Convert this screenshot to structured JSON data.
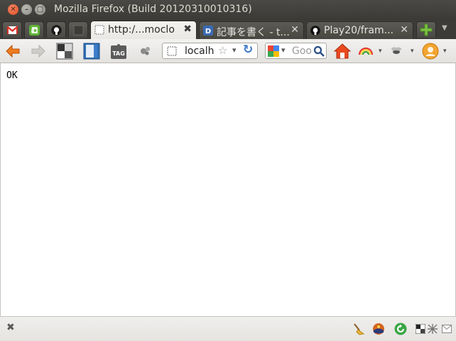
{
  "window": {
    "title": "Mozilla Firefox (Build 20120310010316)",
    "close_glyph": "✕",
    "minimize_glyph": "–",
    "maximize_glyph": "□"
  },
  "tabs": {
    "app_tabs": [
      {
        "icon": "gmail-icon"
      },
      {
        "icon": "evernote-icon"
      },
      {
        "icon": "github-icon"
      },
      {
        "icon": "blank-page-icon"
      }
    ],
    "items": [
      {
        "label": "http:/...moclo",
        "close": "✖",
        "active": true
      },
      {
        "label": "記事を書く - t...",
        "close": "✕",
        "active": false
      },
      {
        "label": "Play20/fram...",
        "close": "✕",
        "active": false
      }
    ],
    "new_tab_glyph": "+",
    "list_tabs_glyph": "▼"
  },
  "toolbar": {
    "url_text": "localh",
    "search_placeholder": "Goo",
    "bookmark_star": "☆",
    "dropdown_glyph": "▾",
    "reload_glyph": "↻",
    "tag_label": "TAG"
  },
  "page": {
    "body_text": "OK"
  },
  "addonbar": {
    "close_glyph": "✖"
  },
  "colors": {
    "titlebar": "#3c3b37",
    "accent_orange": "#e8691f",
    "close_button": "#de4a1d"
  }
}
